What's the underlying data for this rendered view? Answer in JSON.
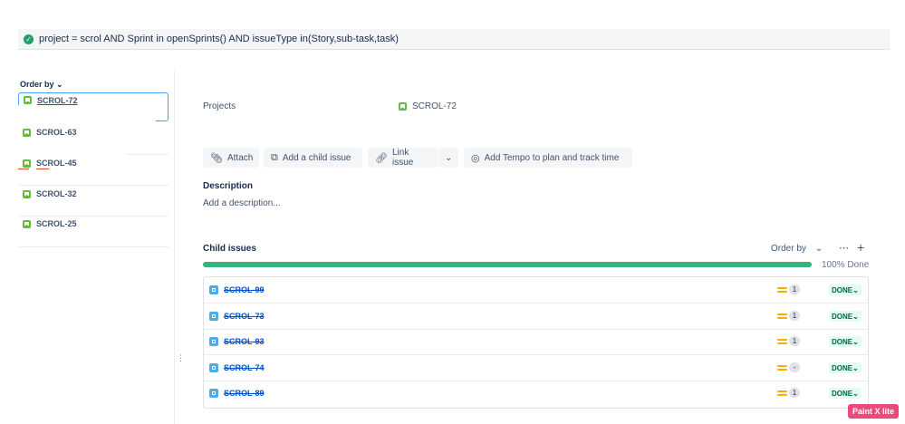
{
  "jql": {
    "query": "project = scrol AND Sprint in openSprints() AND issueType in(Story,sub-task,task)"
  },
  "sidebar": {
    "order_by": "Order by",
    "items": [
      {
        "key": "SCROL-72"
      },
      {
        "key": "SCROL-63"
      },
      {
        "key": "SCROL-45"
      },
      {
        "key": "SCROL-32"
      },
      {
        "key": "SCROL-25"
      }
    ]
  },
  "detail": {
    "projects_label": "Projects",
    "issue_key": "SCROL-72",
    "buttons": {
      "attach": "Attach",
      "add_child": "Add a child issue",
      "link_issue": "Link issue",
      "tempo": "Add Tempo to plan and track time"
    },
    "description_title": "Description",
    "description_placeholder": "Add a description...",
    "child_issues_title": "Child issues",
    "order_by": "Order by",
    "progress_percent": 100,
    "progress_label": "100% Done",
    "children": [
      {
        "key": "SCROL-99",
        "count": "1",
        "status": "DONE"
      },
      {
        "key": "SCROL-73",
        "count": "1",
        "status": "DONE"
      },
      {
        "key": "SCROL-93",
        "count": "1",
        "status": "DONE"
      },
      {
        "key": "SCROL-74",
        "count": "-",
        "status": "DONE"
      },
      {
        "key": "SCROL-89",
        "count": "1",
        "status": "DONE"
      }
    ]
  },
  "watermark": "Paint X lite",
  "colors": {
    "accent": "#0052cc",
    "success": "#36b37e",
    "story": "#63ba3c",
    "subtask": "#4bade8"
  }
}
